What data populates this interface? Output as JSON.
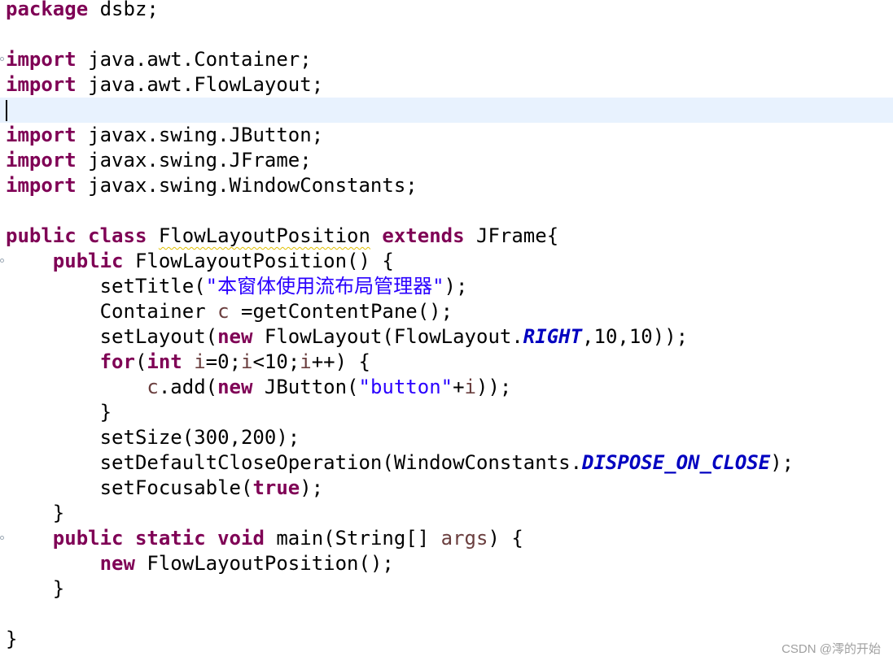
{
  "code": {
    "l1": {
      "kw": "package",
      "rest": " dsbz;"
    },
    "l3": {
      "kw": "import",
      "rest": " java.awt.Container;"
    },
    "l4": {
      "kw": "import",
      "rest": " java.awt.FlowLayout;"
    },
    "l6": {
      "kw": "import",
      "rest": " javax.swing.JButton;"
    },
    "l7": {
      "kw": "import",
      "rest": " javax.swing.JFrame;"
    },
    "l8": {
      "kw": "import",
      "rest": " javax.swing.WindowConstants;"
    },
    "l10": {
      "kw1": "public",
      "kw2": "class",
      "name": "FlowLayoutPosition",
      "kw3": "extends",
      "rest": " JFrame{"
    },
    "l11": {
      "kw": "public",
      "rest": " FlowLayoutPosition() {"
    },
    "l12": {
      "a": "setTitle(",
      "str": "\"本窗体使用流布局管理器\"",
      "b": ");"
    },
    "l13": {
      "a": "Container ",
      "local": "c",
      "b": " =getContentPane();"
    },
    "l14": {
      "a": "setLayout(",
      "kw": "new",
      "b": " FlowLayout(FlowLayout.",
      "const": "RIGHT",
      "c": ",10,10));"
    },
    "l15": {
      "kw1": "for",
      "a": "(",
      "kw2": "int",
      "sp": " ",
      "v1": "i",
      "b": "=0;",
      "v2": "i",
      "c": "<10;",
      "v3": "i",
      "d": "++) {"
    },
    "l16": {
      "local": "c",
      "a": ".add(",
      "kw": "new",
      "b": " JButton(",
      "str": "\"button\"",
      "c": "+",
      "v": "i",
      "d": "));"
    },
    "l17": {
      "text": "}"
    },
    "l18": {
      "text": "setSize(300,200);"
    },
    "l19": {
      "a": "setDefaultCloseOperation(WindowConstants.",
      "const": "DISPOSE_ON_CLOSE",
      "b": ");"
    },
    "l20": {
      "a": "setFocusable(",
      "kw": "true",
      "b": ");"
    },
    "l21": {
      "text": "}"
    },
    "l22": {
      "kw1": "public",
      "kw2": "static",
      "kw3": "void",
      "a": " main(String[] ",
      "local": "args",
      "b": ") {"
    },
    "l23": {
      "kw": "new",
      "rest": " FlowLayoutPosition();"
    },
    "l24": {
      "text": "}"
    },
    "l26": {
      "text": "}"
    }
  },
  "watermark": "CSDN @澪的开始",
  "colors": {
    "keyword": "#7f0055",
    "string": "#2a00ff",
    "static_field": "#0000c0",
    "local_variable": "#6a3e3e",
    "current_line": "#e8f2fe"
  }
}
